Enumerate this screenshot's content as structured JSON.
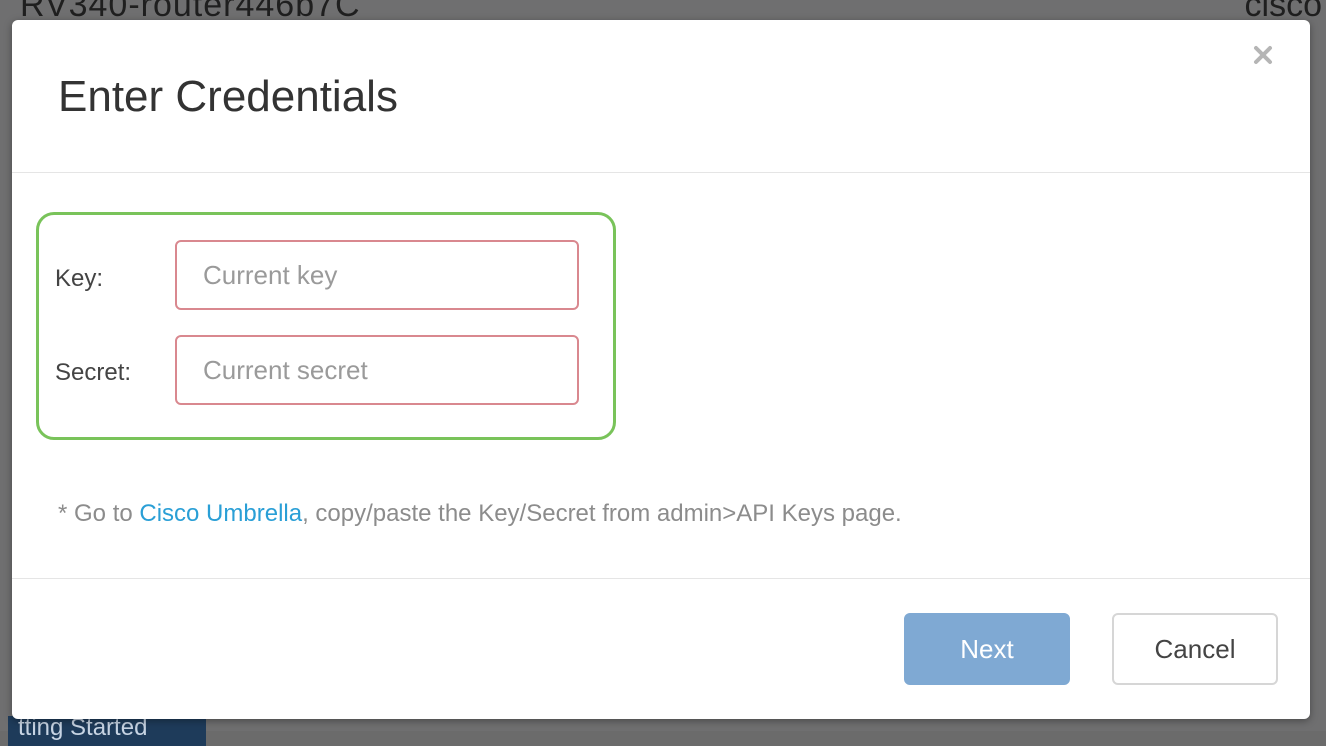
{
  "background": {
    "device_title": "RV340-router446b7C",
    "brand": "cisco",
    "bottom_tab": "tting Started"
  },
  "modal": {
    "title": "Enter Credentials",
    "close_glyph": "×",
    "fields": {
      "key": {
        "label": "Key:",
        "value": "",
        "placeholder": "Current key"
      },
      "secret": {
        "label": "Secret:",
        "value": "",
        "placeholder": "Current secret"
      }
    },
    "note": {
      "prefix": "* Go to ",
      "link": "Cisco Umbrella",
      "suffix": ", copy/paste the Key/Secret from admin>API Keys page."
    },
    "buttons": {
      "next": "Next",
      "cancel": "Cancel"
    }
  },
  "colors": {
    "highlight_border": "#79c35a",
    "invalid_input_border": "#d9888f",
    "primary_button": "#7fa9d3",
    "link": "#2a9fd6"
  },
  "icons": {
    "close": "close-icon"
  }
}
